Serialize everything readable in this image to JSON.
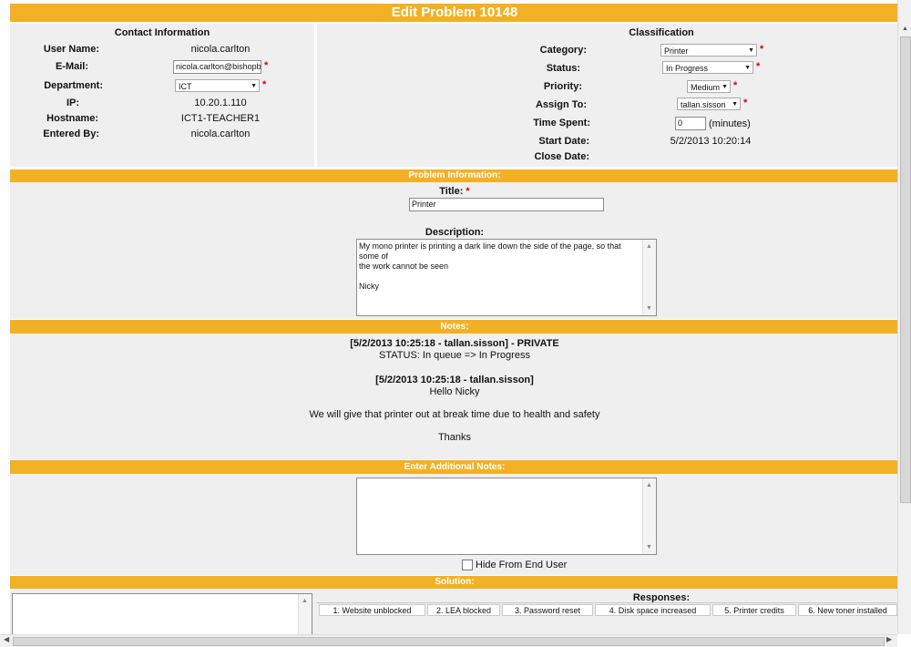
{
  "header": {
    "title": "Edit Problem 10148"
  },
  "contact": {
    "heading": "Contact Information",
    "user_name_label": "User Name:",
    "user_name": "nicola.carlton",
    "email_label": "E-Mail:",
    "email": "nicola.carlton@bishopbar",
    "department_label": "Department:",
    "department": "ICT",
    "ip_label": "IP:",
    "ip": "10.20.1.110",
    "hostname_label": "Hostname:",
    "hostname": "ICT1-TEACHER1",
    "entered_by_label": "Entered By:",
    "entered_by": "nicola.carlton"
  },
  "classification": {
    "heading": "Classification",
    "category_label": "Category:",
    "category": "Printer",
    "status_label": "Status:",
    "status": "In Progress",
    "priority_label": "Priority:",
    "priority": "Medium",
    "assign_label": "Assign To:",
    "assign": "tallan.sisson",
    "time_label": "Time Spent:",
    "time_value": "0",
    "time_unit": "(minutes)",
    "start_label": "Start Date:",
    "start_date": "5/2/2013 10:20:14",
    "close_label": "Close Date:",
    "close_date": ""
  },
  "required_mark": "*",
  "problem": {
    "heading": "Problem Information:",
    "title_label": "Title:",
    "title_value": "Printer",
    "desc_label": "Description:",
    "desc_line1": "My mono printer is printing a dark line down the side of the page, so that some of",
    "desc_line2": "the work cannot be seen",
    "desc_line3": "Nicky"
  },
  "notes": {
    "heading": "Notes:",
    "n1_header": "[5/2/2013 10:25:18 - tallan.sisson] - PRIVATE",
    "n1_body": "STATUS: In queue => In Progress",
    "n2_header": "[5/2/2013 10:25:18 - tallan.sisson]",
    "n2_line1": "Hello Nicky",
    "n2_line2": "We will give that printer out at break time due to health and safety",
    "n2_line3": "Thanks"
  },
  "additional": {
    "heading": "Enter Additional Notes:",
    "hide_label": "Hide From End User",
    "hide_checked": false
  },
  "solution": {
    "heading": "Solution:",
    "responses_label": "Responses:",
    "responses": [
      "1. Website unblocked",
      "2. LEA blocked",
      "3. Password reset",
      "4. Disk space increased",
      "5. Printer credits",
      "6. New toner installed"
    ]
  },
  "colors": {
    "accent": "#f2b125",
    "panel": "#efefef",
    "required": "#dd0000"
  },
  "icons": {
    "dropdown": "chevron-down-icon",
    "scroll_up": "scroll-up-arrow-icon",
    "scroll_down": "scroll-down-arrow-icon"
  }
}
